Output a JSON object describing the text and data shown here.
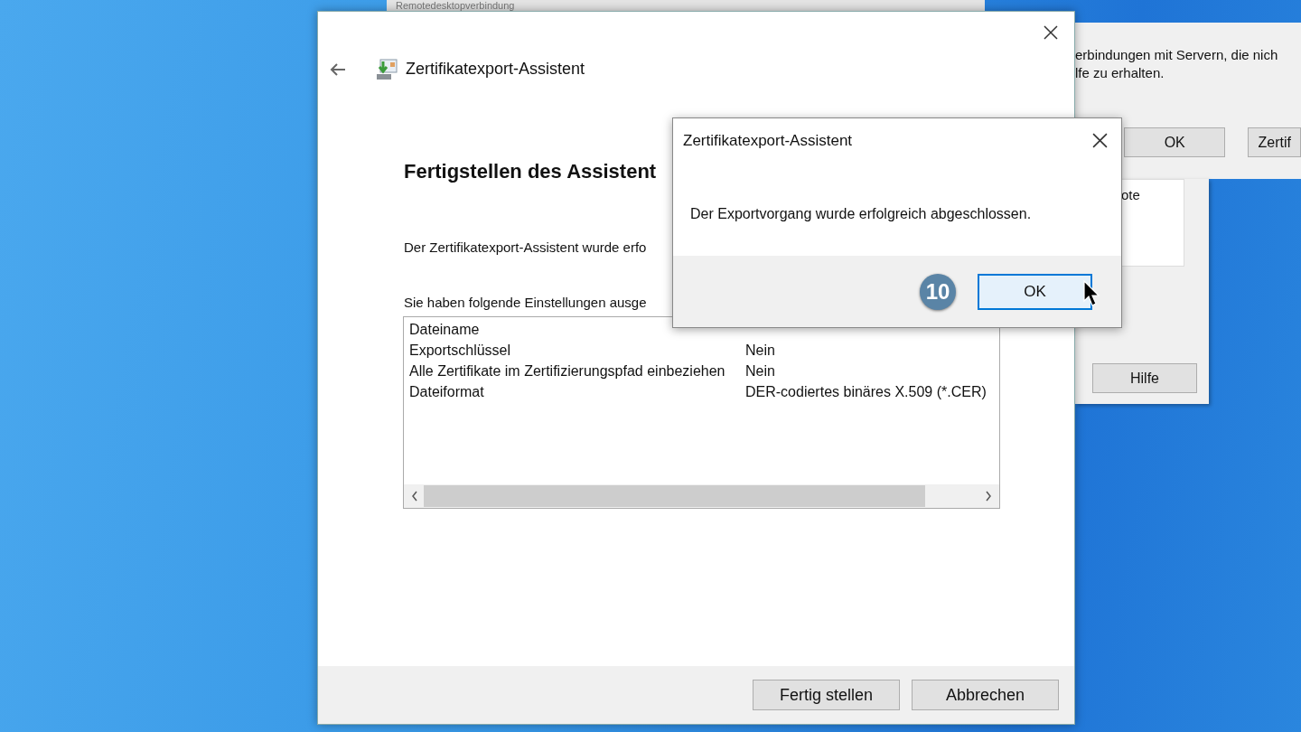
{
  "background_window": {
    "title": "Remotedesktopverbindung",
    "text_lines": [
      "erbindungen mit Servern, die nich",
      "lfe zu erhalten."
    ],
    "buttons": [
      "OK",
      "Zertif"
    ]
  },
  "background_window_2": {
    "text": "ote",
    "buttons": [
      "Hilfe"
    ]
  },
  "wizard": {
    "title": "Zertifikatexport-Assistent",
    "heading": "Fertigstellen des Assistent",
    "intro": "Der Zertifikatexport-Assistent wurde erfo",
    "settings_label": "Sie haben folgende Einstellungen ausge",
    "settings": [
      {
        "name": "Dateiname"
      },
      {
        "name": "Exportschlüssel",
        "value": "Nein"
      },
      {
        "name": "Alle Zertifikate im Zertifizierungspfad einbeziehen",
        "value": "Nein"
      },
      {
        "name": "Dateiformat",
        "value": "DER-codiertes binäres X.509 (*.CER)"
      }
    ],
    "buttons": [
      "Fertig stellen",
      "Abbrechen"
    ]
  },
  "dialog": {
    "title": "Zertifikatexport-Assistent",
    "message": "Der Exportvorgang wurde erfolgreich abgeschlossen.",
    "step_badge": "10",
    "buttons": [
      {
        "label": "OK",
        "focused": true
      }
    ]
  }
}
